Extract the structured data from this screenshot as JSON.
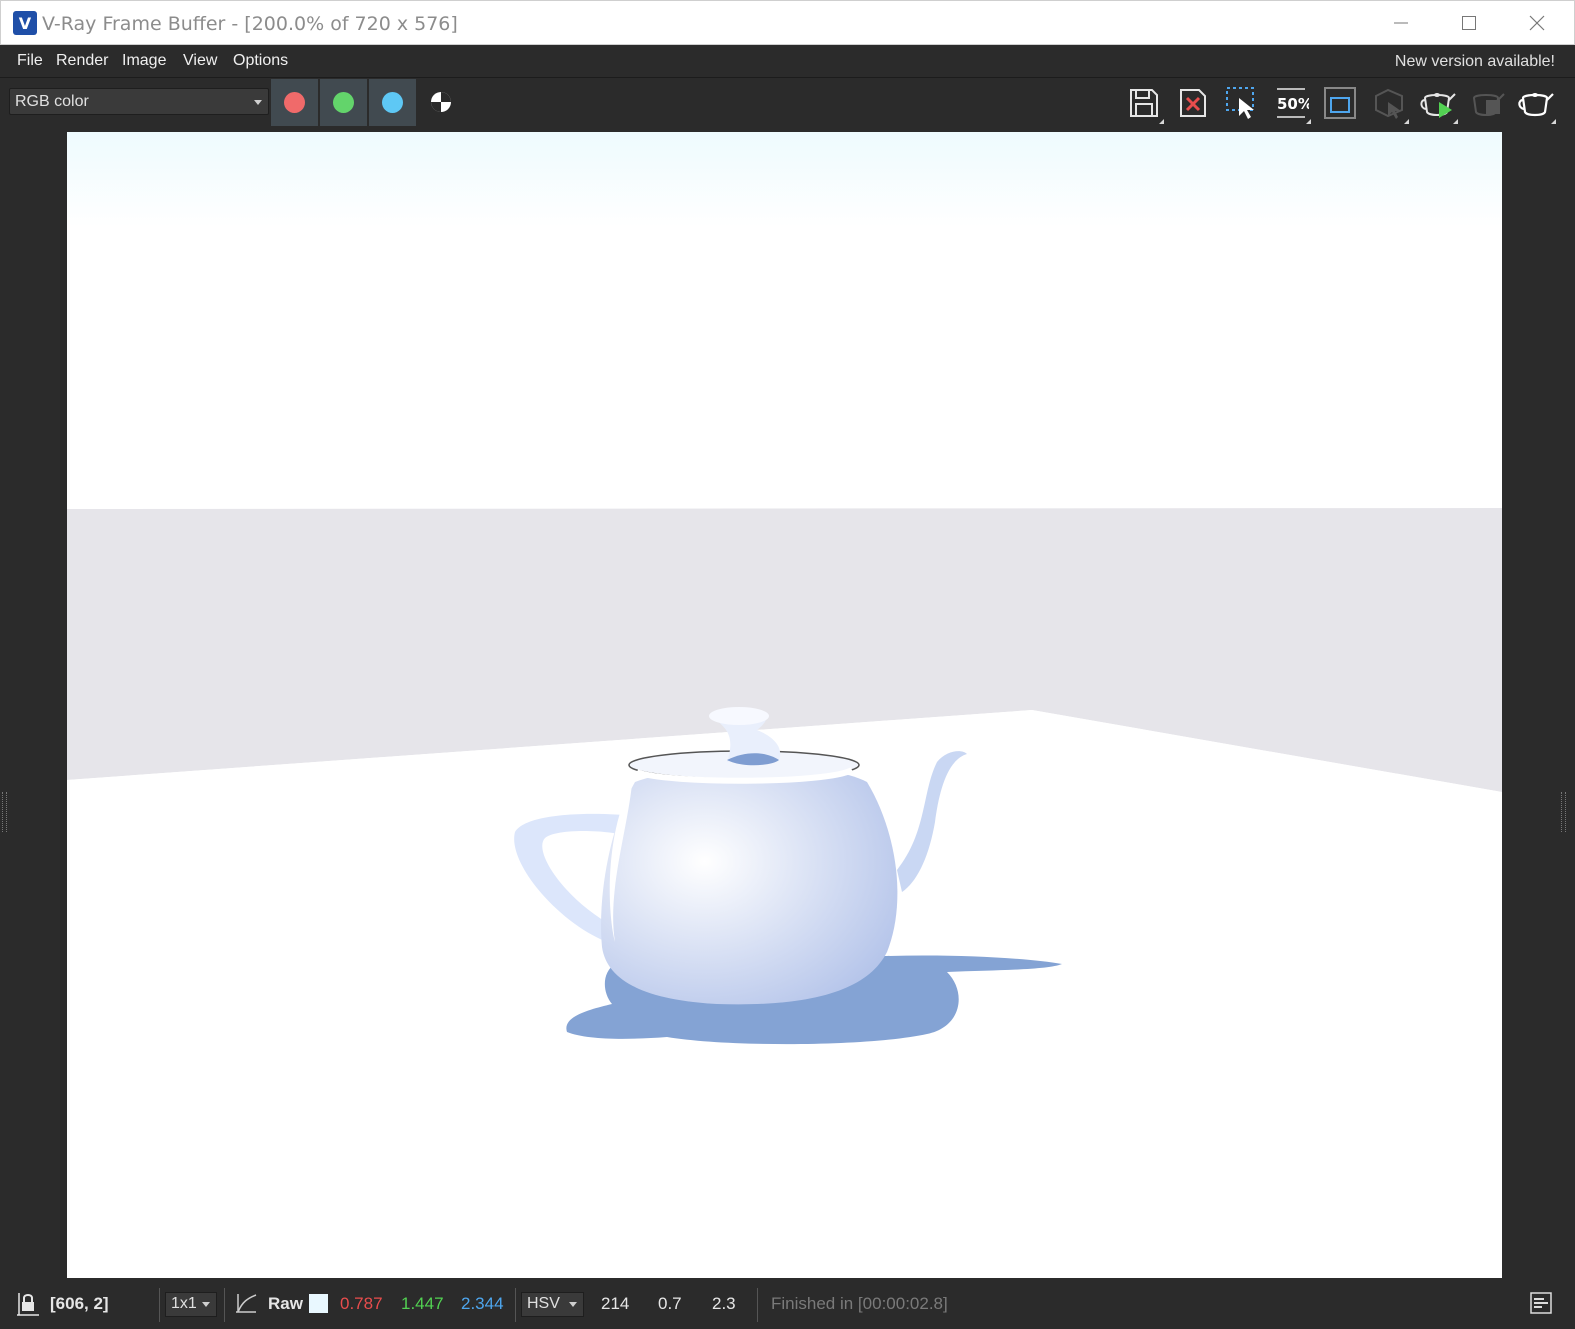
{
  "window": {
    "title": "V-Ray Frame Buffer - [200.0% of 720 x 576]",
    "icon": "vray-icon"
  },
  "menu": {
    "items": [
      {
        "label": "File"
      },
      {
        "label": "Render"
      },
      {
        "label": "Image"
      },
      {
        "label": "View"
      },
      {
        "label": "Options"
      }
    ],
    "notice": "New version available!"
  },
  "toolbar": {
    "channel": "RGB color",
    "channel_buttons": [
      {
        "name": "red-channel",
        "color": "#f06a6a"
      },
      {
        "name": "green-channel",
        "color": "#63d46b"
      },
      {
        "name": "blue-channel",
        "color": "#5ec8f5"
      }
    ],
    "tools": [
      {
        "name": "save-image-icon"
      },
      {
        "name": "clear-image-icon"
      },
      {
        "name": "region-render-icon"
      },
      {
        "name": "zoom-50-icon",
        "text": "50%"
      },
      {
        "name": "show-region-icon"
      },
      {
        "name": "track-mouse-icon"
      },
      {
        "name": "interactive-render-icon"
      },
      {
        "name": "stop-render-icon"
      },
      {
        "name": "render-icon"
      }
    ]
  },
  "status": {
    "coords": "[606, 2]",
    "sample_size": "1x1",
    "color_mode": "Raw",
    "swatch_color": "#e9f8ff",
    "r": "0.787",
    "g": "1.447",
    "b": "2.344",
    "space": "HSV",
    "h": "214",
    "s": "0.7",
    "v": "2.3",
    "message": "Finished in [00:00:02.8]"
  },
  "colors": {
    "accent": "#2d6fd6",
    "r_text": "#e84d4d",
    "g_text": "#52d152",
    "b_text": "#4ea6ee"
  }
}
